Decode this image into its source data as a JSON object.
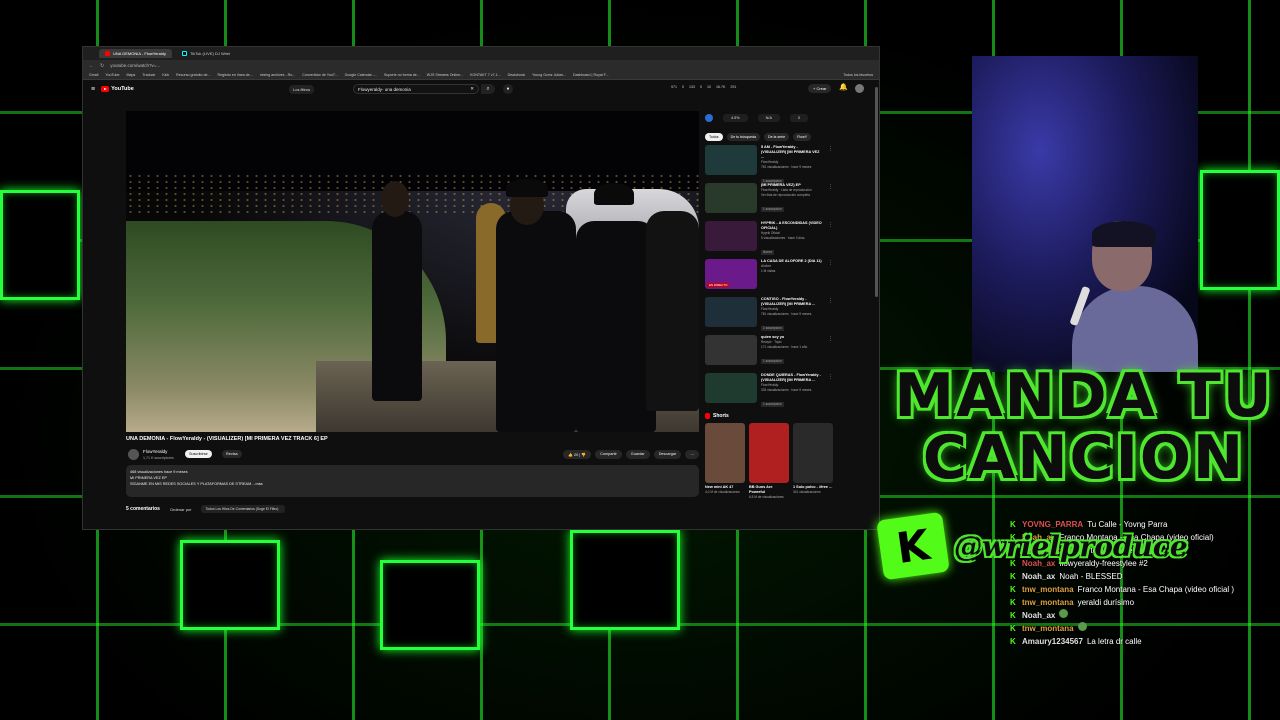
{
  "browser": {
    "tabs": [
      {
        "label": "UNA DEMONIA - FlowYeraldy",
        "active": true
      },
      {
        "label": "TikTok (LIVE) DJ Wriel",
        "active": false
      }
    ],
    "url": "youtube.com/watch?v=...",
    "bookmarks": [
      "Gmail",
      "YouTube",
      "Maps",
      "Traducir",
      "Kick",
      "Recurso gratuito de...",
      "Registro en línea de...",
      "mixing archives - Ro...",
      "Convertidor de YouT...",
      "Google Calendar -...",
      "Suporte no forma de...",
      "WJS Streams Online...",
      "KONTAKT 7 v7.1...",
      "Disclohook",
      "Young Gzmz Julian...",
      "Dashboard | Royal F..."
    ],
    "bookmarks_right": "Todos los favoritos"
  },
  "youtube": {
    "logo_text": "YouTube",
    "filter_chip": "Los filtros",
    "search_query": "Flowyeraldy- una demonia",
    "header_stats": [
      "971",
      "0",
      "133",
      "0",
      "10",
      "16.7K",
      "291"
    ],
    "create_label": "+ Crear"
  },
  "video": {
    "title": "UNA DEMONIA - FlowYeraldy - (VISUALIZER) [MI PRIMERA VEZ TRACK 6] EP",
    "channel": "FlowYeraldy",
    "subs": "1,71 K suscriptores",
    "subscribe_label": "Suscribirse",
    "revisa_label": "Revisa",
    "actions": [
      "20",
      "Compartir",
      "Guardar",
      "Descargar",
      "⋯"
    ],
    "description_lines": [
      "468 visualizaciones hace 9 meses",
      "MI PRIMERA VEZ EP",
      "SÍGANME EN MIS REDES SOCIALES Y PLATAFORMAS DE STREAM     ...más"
    ]
  },
  "comments": {
    "count": "5 comentarios",
    "sort_label": "Ordenar por",
    "select_label": "Todos Los Hilos De Comentarios (Suge El Filtro)"
  },
  "sidebar": {
    "ext_values": [
      "4.5%",
      "N/A",
      "0"
    ],
    "chips": [
      "Todos",
      "De tu búsqueda",
      "De la serie",
      "FlowY"
    ],
    "recs": [
      {
        "title": "5 AM - FlowYeraldy - (VISUALIZER) [MI PRIMERA VEZ ...",
        "meta1": "FlowYeraldy",
        "meta2": "781 visualizaciones · hace 9 meses",
        "badge": "1 suscripción",
        "thumb": "#1f3a3a"
      },
      {
        "title": "(MI PRIMERA VEZ) EP",
        "meta1": "FlowYeraldy · Lista de reproducción",
        "meta2": "Ver lista de reproducción completa",
        "badge": "1 suscripción",
        "thumb": "#2a3a2a"
      },
      {
        "title": "HYPRIK - A ESCONDIDAS (VIDEO OFICIAL)",
        "meta1": "Hyprik Oficial",
        "meta2": "5 visualizaciones · hace 3 días",
        "badge": "Nuevo",
        "thumb": "#3a1a3a"
      },
      {
        "title": "LA CASA DE ALOFORE 2 (DIA 11)",
        "meta1": "Alofore",
        "meta2": "1 M vistas",
        "badge": "EN DIRECTO",
        "thumb": "#6a1a8a"
      },
      {
        "title": "CONTIGO - FlowYeraldy - (VISUALIZER) [MI PRIMERA ...",
        "meta1": "FlowYeraldy",
        "meta2": "781 visualizaciones · hace 9 meses",
        "badge": "1 suscripción",
        "thumb": "#1f2f3a"
      },
      {
        "title": "quien soy yo",
        "meta1": "Rewyio · Topic",
        "meta2": "171 visualizaciones · hace 1 año",
        "badge": "1 suscripción",
        "thumb": "#333333"
      },
      {
        "title": "DONDE QUIERAS - FlowYeraldy - (VISUALIZER) [MI PRIMERA ...",
        "meta1": "FlowYeraldy",
        "meta2": "333 visualizaciones · hace 9 meses",
        "badge": "1 suscripción",
        "thumb": "#1f3a2f"
      }
    ],
    "shorts_heading": "Shorts",
    "shorts": [
      {
        "title": "New mini AK 47",
        "views": "4,0 M de visualizaciones",
        "color": "#6a4a3a"
      },
      {
        "title": "BB Guns Are Powerful",
        "views": "6,5 M de visualizaciones",
        "color": "#b02020"
      },
      {
        "title": "1 Solo polvo - #free ...",
        "views": "341 visualizaciones",
        "color": "#2a2a2a"
      }
    ]
  },
  "overlay": {
    "line1": "MANDA TU",
    "line2": "CANCION",
    "kick_letter": "K",
    "handle": "@wrielproduce"
  },
  "chat": [
    {
      "user": "YOVNG_PARRA",
      "text": "Tu Calle - Yovng Parra",
      "color": "#e05050"
    },
    {
      "user": "Noah_ax",
      "text": "Franco Montana - Esa Chapa (video oficial)",
      "color": "#e0a040"
    },
    {
      "user": "tnw_montana",
      "text": "Cartel - Yankee Logan",
      "color": "#e0a040"
    },
    {
      "user": "Noah_ax",
      "text": "flowyeraldy-freestylee #2",
      "color": "#e05050"
    },
    {
      "user": "Noah_ax",
      "text": "Noah - BLESSED",
      "color": "#e0e0e0"
    },
    {
      "user": "tnw_montana",
      "text": "Franco Montana - Esa Chapa (video oficial )",
      "color": "#e0a040"
    },
    {
      "user": "tnw_montana",
      "text": "yeraldi durísimo",
      "color": "#e0a040"
    },
    {
      "user": "Noah_ax",
      "text": "",
      "color": "#e0e0e0"
    },
    {
      "user": "tnw_montana",
      "text": "",
      "color": "#e0a040"
    },
    {
      "user": "Amaury1234567",
      "text": "La letra dr calle",
      "color": "#e0e0e0"
    }
  ]
}
